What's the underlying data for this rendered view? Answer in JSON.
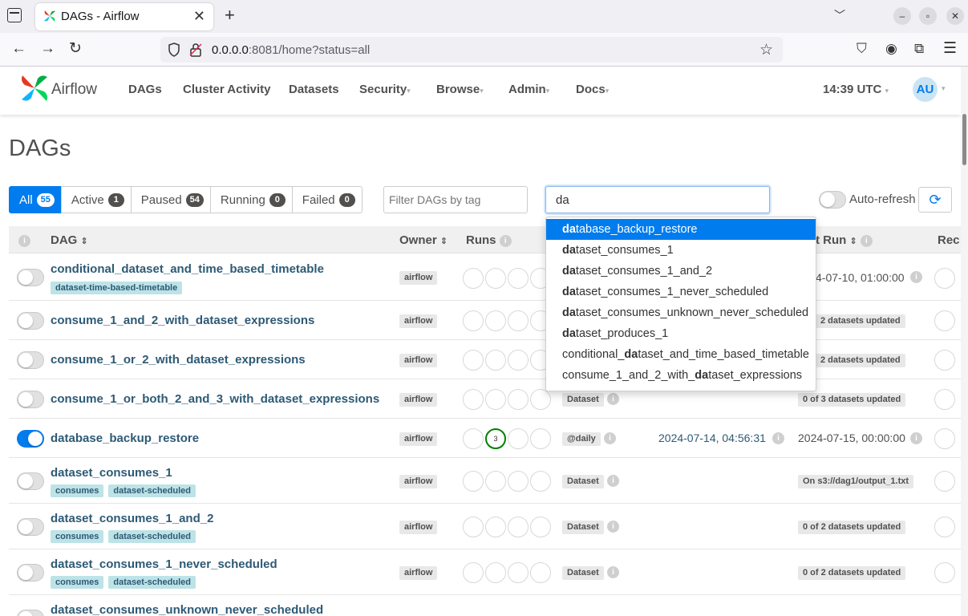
{
  "browser": {
    "tab_title": "DAGs - Airflow",
    "url_host": "0.0.0.0",
    "url_rest": ":8081/home?status=all"
  },
  "nav": {
    "brand": "Airflow",
    "items": [
      {
        "label": "DAGs",
        "caret": false
      },
      {
        "label": "Cluster Activity",
        "caret": false
      },
      {
        "label": "Datasets",
        "caret": false
      },
      {
        "label": "Security",
        "caret": true
      },
      {
        "label": "Browse",
        "caret": true
      },
      {
        "label": "Admin",
        "caret": true
      },
      {
        "label": "Docs",
        "caret": true
      }
    ],
    "time": "14:39 UTC",
    "avatar": "AU"
  },
  "page": {
    "title": "DAGs",
    "status_filters": [
      {
        "label": "All",
        "count": "55",
        "active": true
      },
      {
        "label": "Active",
        "count": "1",
        "active": false
      },
      {
        "label": "Paused",
        "count": "54",
        "active": false
      },
      {
        "label": "Running",
        "count": "0",
        "active": false
      },
      {
        "label": "Failed",
        "count": "0",
        "active": false
      }
    ],
    "tag_filter_placeholder": "Filter DAGs by tag",
    "search_value": "da",
    "autorefresh_label": "Auto-refresh"
  },
  "table": {
    "headers": {
      "info": "i",
      "dag": "DAG",
      "owner": "Owner",
      "runs": "Runs",
      "last_run": "t Run",
      "recent": "Rec"
    },
    "rows": [
      {
        "name": "conditional_dataset_and_time_based_timetable",
        "tags": [
          "dataset-time-based-timetable"
        ],
        "owner": "airflow",
        "active": false,
        "schedule": "",
        "last_run": "",
        "next_run": "4-07-10, 01:00:00",
        "next_pill": ""
      },
      {
        "name": "consume_1_and_2_with_dataset_expressions",
        "tags": [],
        "owner": "airflow",
        "active": false,
        "schedule": "",
        "last_run": "",
        "next_run": "",
        "next_pill": "2 datasets updated"
      },
      {
        "name": "consume_1_or_2_with_dataset_expressions",
        "tags": [],
        "owner": "airflow",
        "active": false,
        "schedule": "",
        "last_run": "",
        "next_run": "",
        "next_pill": "2 datasets updated"
      },
      {
        "name": "consume_1_or_both_2_and_3_with_dataset_expressions",
        "tags": [],
        "owner": "airflow",
        "active": false,
        "schedule": "Dataset",
        "last_run": "",
        "next_run": "",
        "next_pill": "0 of 3 datasets updated"
      },
      {
        "name": "database_backup_restore",
        "tags": [],
        "owner": "airflow",
        "active": true,
        "schedule": "@daily",
        "last_run": "2024-07-14, 04:56:31",
        "next_run": "2024-07-15, 00:00:00",
        "next_pill": "",
        "success_runs": "3"
      },
      {
        "name": "dataset_consumes_1",
        "tags": [
          "consumes",
          "dataset-scheduled"
        ],
        "owner": "airflow",
        "active": false,
        "schedule": "Dataset",
        "last_run": "",
        "next_run": "",
        "next_pill": "On s3://dag1/output_1.txt"
      },
      {
        "name": "dataset_consumes_1_and_2",
        "tags": [
          "consumes",
          "dataset-scheduled"
        ],
        "owner": "airflow",
        "active": false,
        "schedule": "Dataset",
        "last_run": "",
        "next_run": "",
        "next_pill": "0 of 2 datasets updated"
      },
      {
        "name": "dataset_consumes_1_never_scheduled",
        "tags": [
          "consumes",
          "dataset-scheduled"
        ],
        "owner": "airflow",
        "active": false,
        "schedule": "Dataset",
        "last_run": "",
        "next_run": "",
        "next_pill": "0 of 2 datasets updated"
      },
      {
        "name": "dataset_consumes_unknown_never_scheduled",
        "tags": [],
        "owner": "",
        "active": false,
        "schedule": "",
        "last_run": "",
        "next_run": "",
        "next_pill": ""
      }
    ]
  },
  "autocomplete": [
    {
      "pre": "",
      "match": "da",
      "post": "tabase_backup_restore",
      "selected": true
    },
    {
      "pre": "",
      "match": "da",
      "post": "taset_consumes_1",
      "selected": false
    },
    {
      "pre": "",
      "match": "da",
      "post": "taset_consumes_1_and_2",
      "selected": false
    },
    {
      "pre": "",
      "match": "da",
      "post": "taset_consumes_1_never_scheduled",
      "selected": false
    },
    {
      "pre": "",
      "match": "da",
      "post": "taset_consumes_unknown_never_scheduled",
      "selected": false
    },
    {
      "pre": "",
      "match": "da",
      "post": "taset_produces_1",
      "selected": false
    },
    {
      "pre": "conditional_",
      "match": "da",
      "post": "taset_and_time_based_timetable",
      "selected": false
    },
    {
      "pre": "consume_1_and_2_with_",
      "match": "da",
      "post": "taset_expressions",
      "selected": false
    }
  ],
  "colors": {
    "accent": "#017cee",
    "success": "#008000",
    "link": "#2d5a75"
  }
}
